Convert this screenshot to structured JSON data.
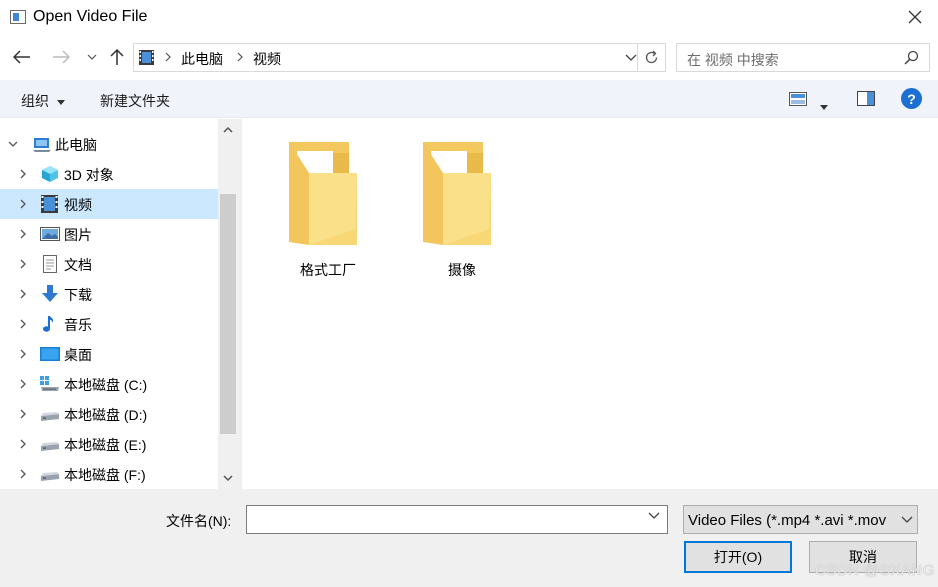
{
  "window": {
    "title": "Open Video File"
  },
  "nav": {
    "breadcrumb": [
      "此电脑",
      "视频"
    ],
    "search_placeholder": "在 视频 中搜索"
  },
  "toolbar": {
    "organize_label": "组织",
    "new_folder_label": "新建文件夹",
    "help_label": "?"
  },
  "tree": {
    "items": [
      {
        "label": "此电脑",
        "icon": "pc-icon",
        "level": 0,
        "expanded": true,
        "selected": false
      },
      {
        "label": "3D 对象",
        "icon": "3d-objects-icon",
        "level": 1,
        "selected": false
      },
      {
        "label": "视频",
        "icon": "video-icon",
        "level": 1,
        "selected": true
      },
      {
        "label": "图片",
        "icon": "pictures-icon",
        "level": 1,
        "selected": false
      },
      {
        "label": "文档",
        "icon": "documents-icon",
        "level": 1,
        "selected": false
      },
      {
        "label": "下载",
        "icon": "download-icon",
        "level": 1,
        "selected": false
      },
      {
        "label": "音乐",
        "icon": "music-icon",
        "level": 1,
        "selected": false
      },
      {
        "label": "桌面",
        "icon": "desktop-icon",
        "level": 1,
        "selected": false
      },
      {
        "label": "本地磁盘 (C:)",
        "icon": "system-drive-icon",
        "level": 1,
        "selected": false
      },
      {
        "label": "本地磁盘 (D:)",
        "icon": "drive-icon",
        "level": 1,
        "selected": false
      },
      {
        "label": "本地磁盘 (E:)",
        "icon": "drive-icon",
        "level": 1,
        "selected": false
      },
      {
        "label": "本地磁盘 (F:)",
        "icon": "drive-icon",
        "level": 1,
        "selected": false
      }
    ]
  },
  "content": {
    "folders": [
      {
        "name": "格式工厂",
        "icon": "folder-icon"
      },
      {
        "name": "摄像",
        "icon": "folder-icon"
      }
    ]
  },
  "bottom": {
    "filename_label": "文件名(N):",
    "filename_value": "",
    "filetype_value": "Video Files (*.mp4 *.avi *.mov",
    "open_label": "打开(O)",
    "cancel_label": "取消"
  },
  "watermark": "CSDN @SXANG",
  "colors": {
    "selection": "#cce8ff",
    "accent": "#0078d7",
    "toolbar_bg": "#f0f3f9",
    "folder": "#f8d775"
  }
}
